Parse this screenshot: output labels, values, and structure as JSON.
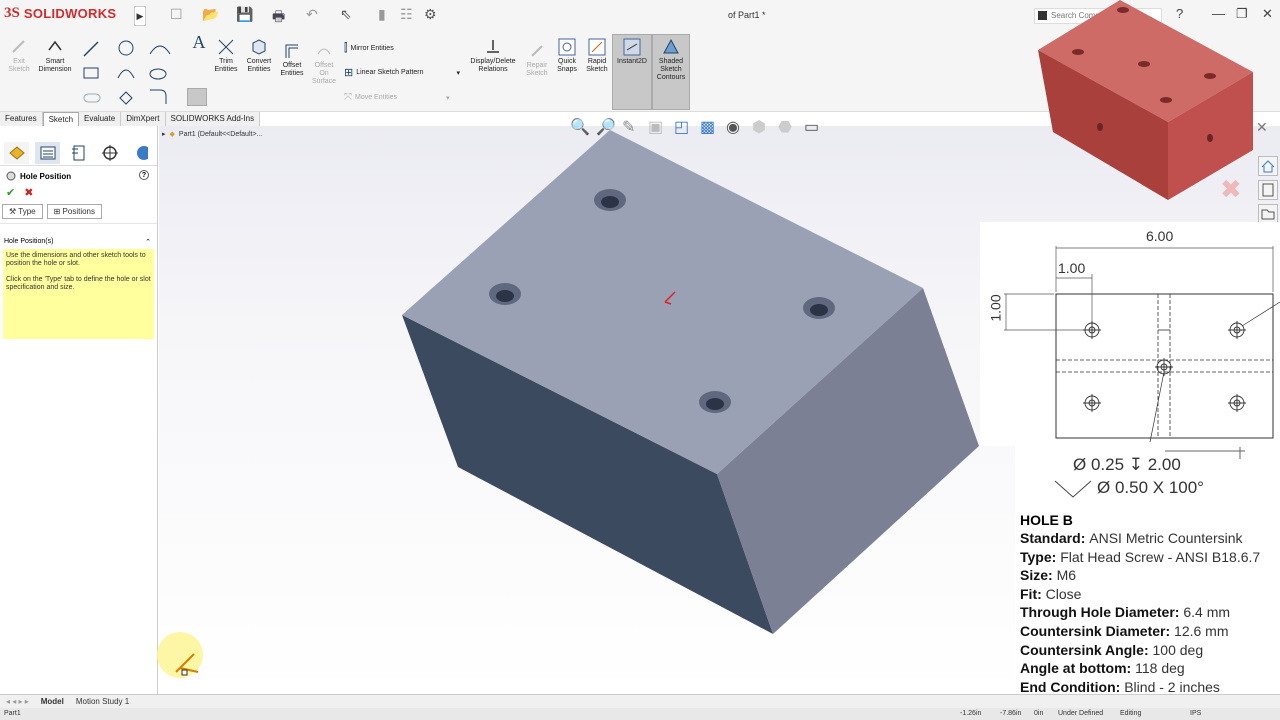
{
  "app": {
    "brand": "SOLIDWORKS",
    "brand_prefix": "3S",
    "doc_title": "of Part1 *"
  },
  "search": {
    "placeholder": "Search Comm"
  },
  "toolbar": {
    "exit_sketch": "Exit\nSketch",
    "smart_dimension": "Smart\nDimension",
    "trim_entities": "Trim\nEntities",
    "convert_entities": "Convert\nEntities",
    "offset_entities": "Offset\nEntities",
    "offset_on_surface": "Offset\nOn\nSurface",
    "mirror_entities": "Mirror Entities",
    "linear_sketch_pattern": "Linear Sketch Pattern",
    "move_entities": "Move Entities",
    "display_delete_relations": "Display/Delete\nRelations",
    "repair_sketch": "Repair\nSketch",
    "quick_snaps": "Quick\nSnaps",
    "rapid_sketch": "Rapid\nSketch",
    "instant2d": "Instant2D",
    "shaded_sketch_contours": "Shaded\nSketch\nContours"
  },
  "tabs": [
    "Features",
    "Sketch",
    "Evaluate",
    "DimXpert",
    "SOLIDWORKS Add-Ins"
  ],
  "active_tab": "Sketch",
  "tree": {
    "root": "Part1  (Default<<Default>..."
  },
  "property_manager": {
    "title": "Hole Position",
    "tab_type": "Type",
    "tab_positions": "Positions",
    "section": "Hole Position(s)",
    "msg1": "Use the dimensions and other sketch tools to position the hole or slot.",
    "msg2": "Click on the 'Type' tab to define the hole or slot specification and size."
  },
  "drawing": {
    "dim_total": "6.00",
    "dim_x": "1.00",
    "dim_y": "1.00"
  },
  "spec": {
    "line1": "Ø 0.25 ↧ 2.00",
    "line2": "Ø 0.50 X 100°"
  },
  "hole": {
    "name": "HOLE B",
    "rows": [
      {
        "k": "Standard",
        "v": "ANSI Metric Countersink"
      },
      {
        "k": "Type",
        "v": "Flat Head Screw - ANSI B18.6.7"
      },
      {
        "k": "Size",
        "v": "M6"
      },
      {
        "k": "Fit",
        "v": "Close"
      },
      {
        "k": "Through Hole Diameter",
        "v": "6.4 mm"
      },
      {
        "k": "Countersink Diameter",
        "v": "12.6 mm"
      },
      {
        "k": "Countersink Angle",
        "v": "100 deg"
      },
      {
        "k": "Angle at bottom",
        "v": "118 deg"
      },
      {
        "k": "End Condition",
        "v": "Blind - 2 inches"
      }
    ]
  },
  "bottom_tabs": [
    "Model",
    "Motion Study 1"
  ],
  "status": {
    "doc": "Part1",
    "x": "-1.26in",
    "y": "-7.86in",
    "z": "0in",
    "defined": "Under Defined",
    "mode": "Editing",
    "units": "IPS"
  },
  "colors": {
    "accent": "#d32b2b",
    "part_face_top": "#9aa1b4",
    "part_face_left": "#3c4a60",
    "preview": "#c0504d",
    "note": "#ffff9e"
  }
}
